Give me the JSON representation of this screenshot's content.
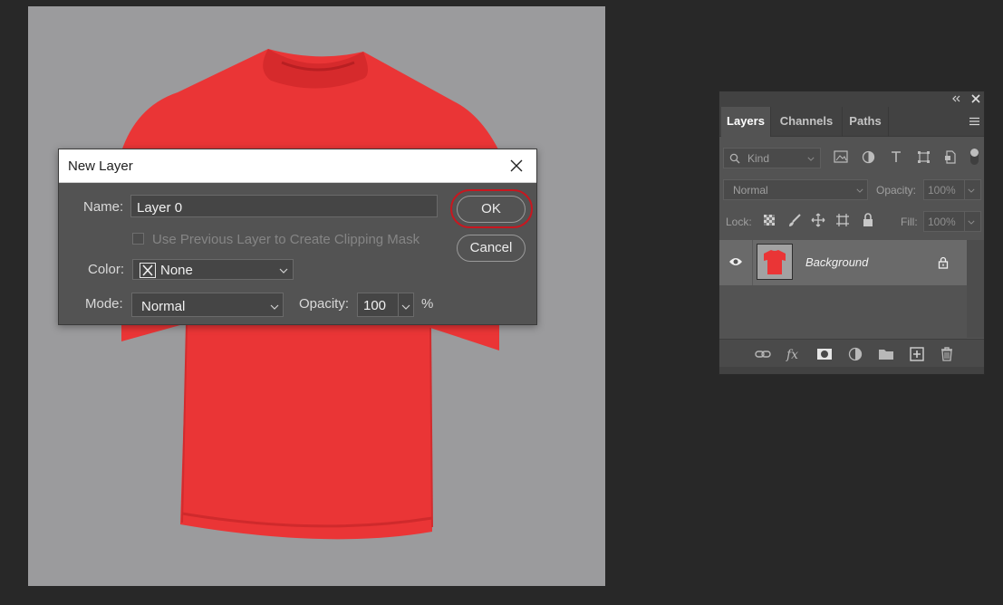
{
  "dialog": {
    "title": "New Layer",
    "name_label": "Name:",
    "name_value": "Layer 0",
    "clipping_label": "Use Previous Layer to Create Clipping Mask",
    "color_label": "Color:",
    "color_value": "None",
    "mode_label": "Mode:",
    "mode_value": "Normal",
    "opacity_label": "Opacity:",
    "opacity_value": "100",
    "opacity_unit": "%",
    "ok_label": "OK",
    "cancel_label": "Cancel",
    "highlight_color": "#c8171f"
  },
  "layers_panel": {
    "tabs": [
      "Layers",
      "Channels",
      "Paths"
    ],
    "active_tab": "Layers",
    "filter_placeholder": "Kind",
    "blend_mode": "Normal",
    "opacity_label": "Opacity:",
    "opacity_value": "100%",
    "lock_label": "Lock:",
    "fill_label": "Fill:",
    "fill_value": "100%",
    "layers": [
      {
        "name": "Background",
        "visible": true,
        "locked": true
      }
    ]
  },
  "canvas": {
    "background_color": "#9b9b9d",
    "shirt_color": "#ea3536"
  }
}
